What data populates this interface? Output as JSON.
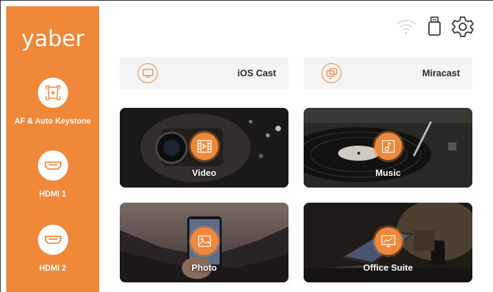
{
  "brand": {
    "logo_text": "yaber",
    "accent_color": "#f0883a"
  },
  "sidebar": {
    "items": [
      {
        "label": "AF & Auto Keystone",
        "icon": "keystone-icon"
      },
      {
        "label": "HDMI 1",
        "icon": "hdmi-icon"
      },
      {
        "label": "HDMI 2",
        "icon": "hdmi-icon"
      }
    ]
  },
  "status_bar": {
    "icons": [
      "wifi-icon",
      "usb-drive-icon",
      "settings-gear-icon"
    ]
  },
  "cast": {
    "items": [
      {
        "label": "iOS Cast",
        "icon": "screen-cast-icon"
      },
      {
        "label": "Miracast",
        "icon": "mirror-screens-icon"
      }
    ]
  },
  "apps": {
    "tiles": [
      {
        "label": "Video",
        "icon": "film-icon"
      },
      {
        "label": "Music",
        "icon": "music-note-icon"
      },
      {
        "label": "Photo",
        "icon": "image-icon"
      },
      {
        "label": "Office Suite",
        "icon": "chart-screen-icon"
      }
    ]
  }
}
